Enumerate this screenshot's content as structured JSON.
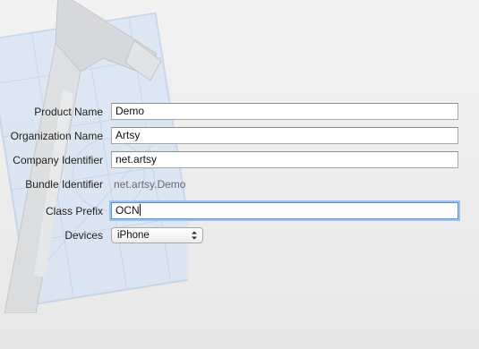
{
  "form": {
    "product_name": {
      "label": "Product Name",
      "value": "Demo"
    },
    "organization_name": {
      "label": "Organization Name",
      "value": "Artsy"
    },
    "company_identifier": {
      "label": "Company Identifier",
      "value": "net.artsy"
    },
    "bundle_identifier": {
      "label": "Bundle Identifier",
      "value": "net.artsy.Demo"
    },
    "class_prefix": {
      "label": "Class Prefix",
      "value": "OCN"
    },
    "devices": {
      "label": "Devices",
      "selected": "iPhone"
    }
  },
  "background": {
    "icon": "xcode-hammer-blueprint-icon",
    "blueprint_color": "#cfe0f7",
    "hammer_color": "#b8bcc2"
  },
  "colors": {
    "focus_ring": "#9ec2f0",
    "window_background": "#ececec"
  }
}
